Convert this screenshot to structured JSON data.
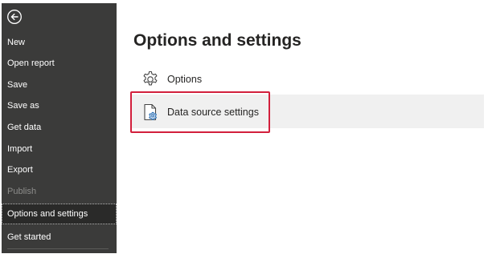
{
  "sidebar": {
    "back_icon": "back-arrow-icon",
    "items": [
      {
        "label": "New",
        "state": "normal"
      },
      {
        "label": "Open report",
        "state": "normal"
      },
      {
        "label": "Save",
        "state": "normal"
      },
      {
        "label": "Save as",
        "state": "normal"
      },
      {
        "label": "Get data",
        "state": "normal"
      },
      {
        "label": "Import",
        "state": "normal"
      },
      {
        "label": "Export",
        "state": "normal"
      },
      {
        "label": "Publish",
        "state": "disabled"
      },
      {
        "label": "Options and settings",
        "state": "selected"
      },
      {
        "label": "Get started",
        "state": "normal"
      }
    ]
  },
  "main": {
    "title": "Options and settings",
    "options": [
      {
        "label": "Options",
        "icon": "gear-icon"
      },
      {
        "label": "Data source settings",
        "icon": "data-source-settings-icon",
        "highlighted": true
      }
    ]
  },
  "colors": {
    "sidebar_bg": "#3b3b3a",
    "highlight_border": "#d21f3c",
    "row_band": "#f0f0f0"
  }
}
